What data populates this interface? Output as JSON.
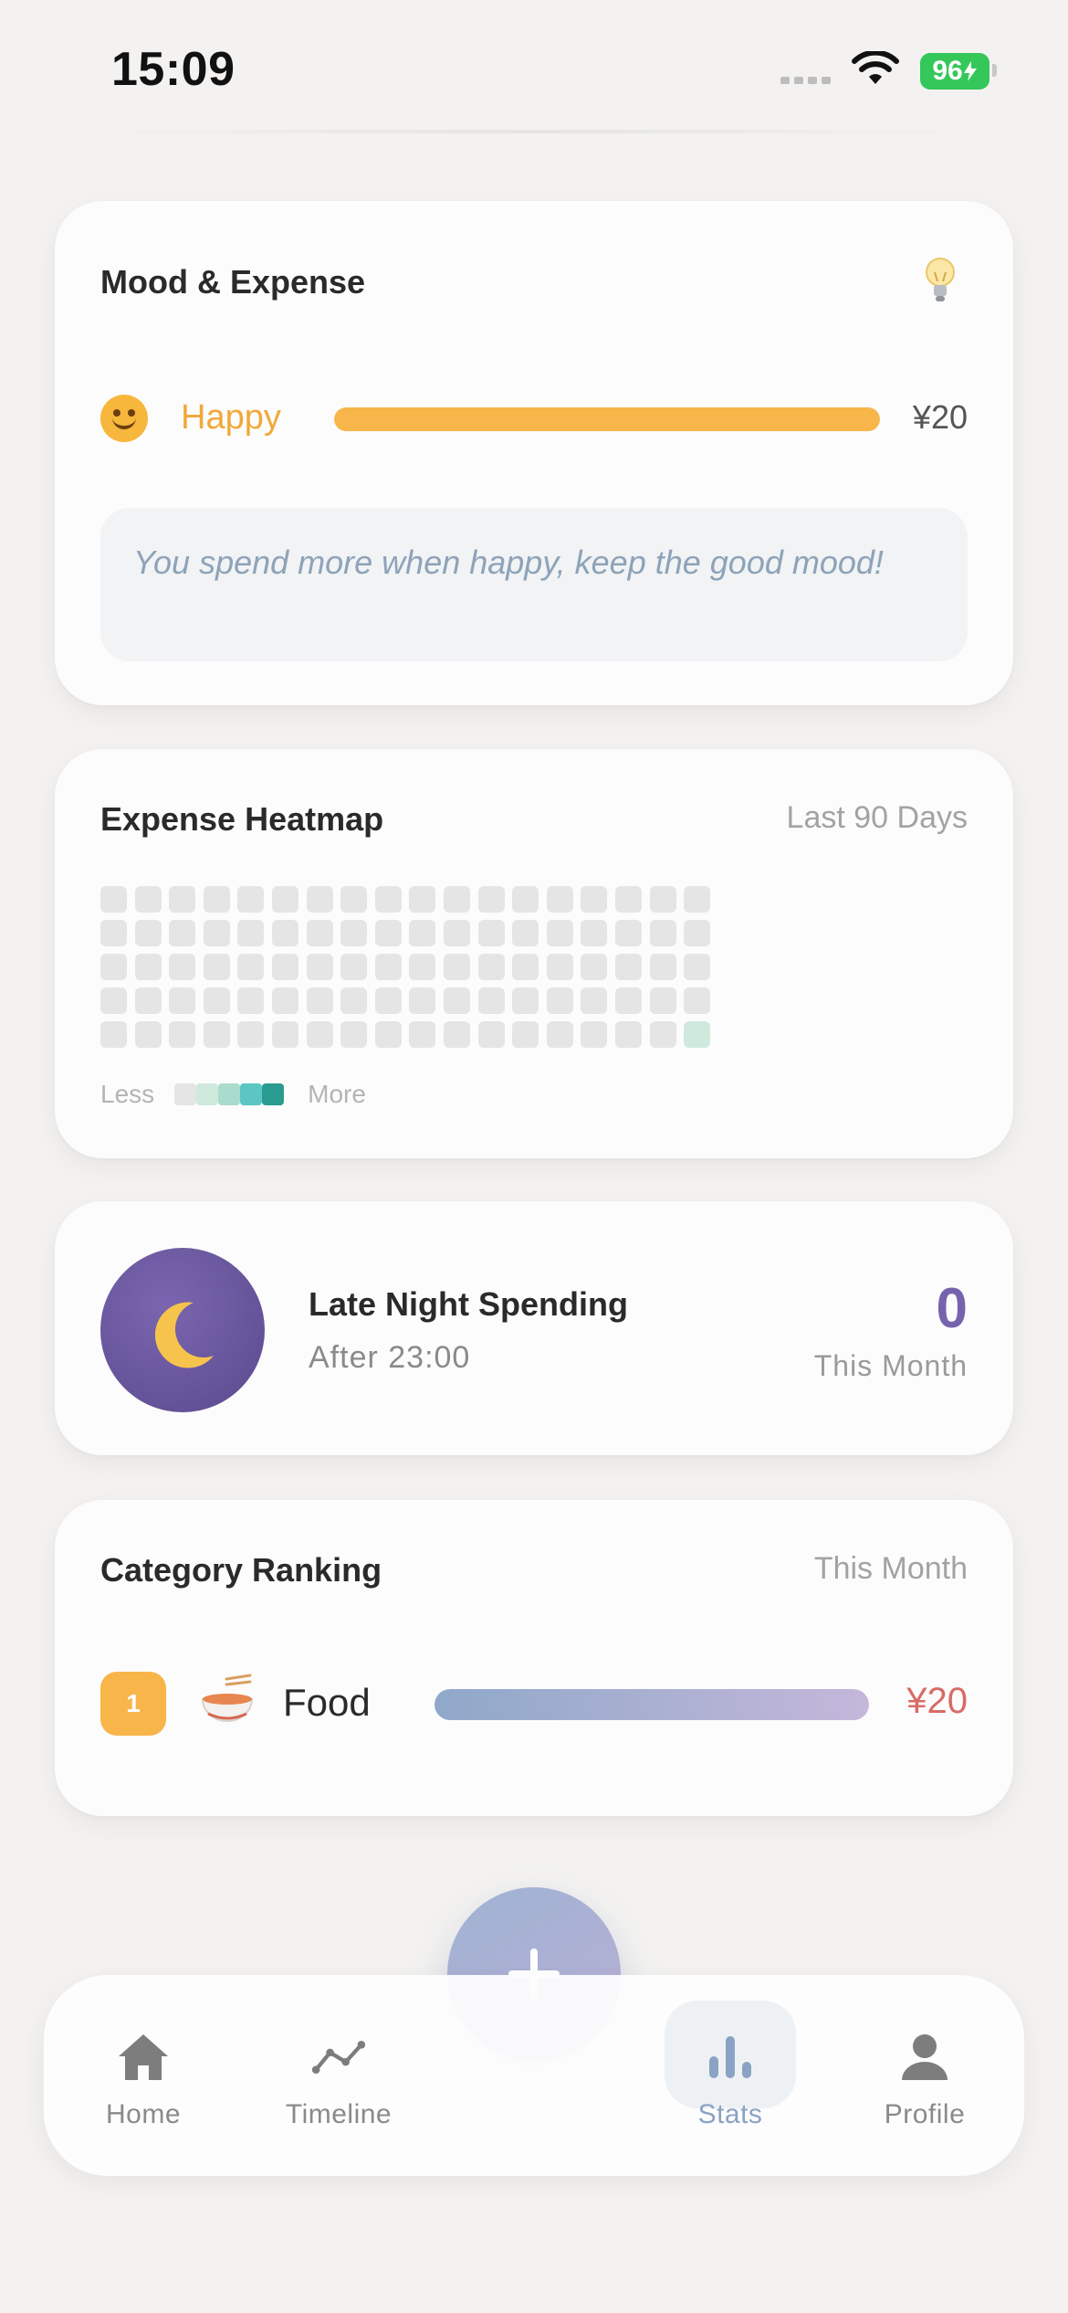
{
  "status_bar": {
    "time": "15:09",
    "battery": "96"
  },
  "mood_card": {
    "title": "Mood & Expense",
    "mood_label": "Happy",
    "amount": "¥20",
    "bar_fraction": 1.0,
    "tip": "You spend more when happy, keep the good mood!"
  },
  "heatmap_card": {
    "title": "Expense Heatmap",
    "period": "Last 90 Days",
    "rows": 5,
    "cols": 18,
    "active_cells": [
      {
        "row": 4,
        "col": 17,
        "level": 1
      }
    ],
    "legend_less": "Less",
    "legend_more": "More",
    "level_colors": [
      "#e5e5e5",
      "#cfe9dd",
      "#a9dccc",
      "#5bc6c4",
      "#2a9c8f"
    ]
  },
  "night_card": {
    "title": "Late Night Spending",
    "subtitle": "After 23:00",
    "count": "0",
    "period": "This Month"
  },
  "category_card": {
    "title": "Category Ranking",
    "period": "This Month",
    "items": [
      {
        "rank": "1",
        "icon": "noodle-bowl-icon",
        "name": "Food",
        "amount": "¥20",
        "fraction": 1.0
      }
    ]
  },
  "bottom_nav": {
    "items": [
      {
        "label": "Home",
        "icon": "home-icon"
      },
      {
        "label": "Timeline",
        "icon": "timeline-icon"
      },
      {
        "label": "Stats",
        "icon": "stats-icon",
        "active": true
      },
      {
        "label": "Profile",
        "icon": "profile-icon"
      }
    ],
    "fab_icon": "plus-icon"
  },
  "colors": {
    "accent_orange": "#f7b54a",
    "accent_purple": "#7763ad",
    "amount_red": "#d86b66",
    "stats_active": "#8aa3c4"
  }
}
